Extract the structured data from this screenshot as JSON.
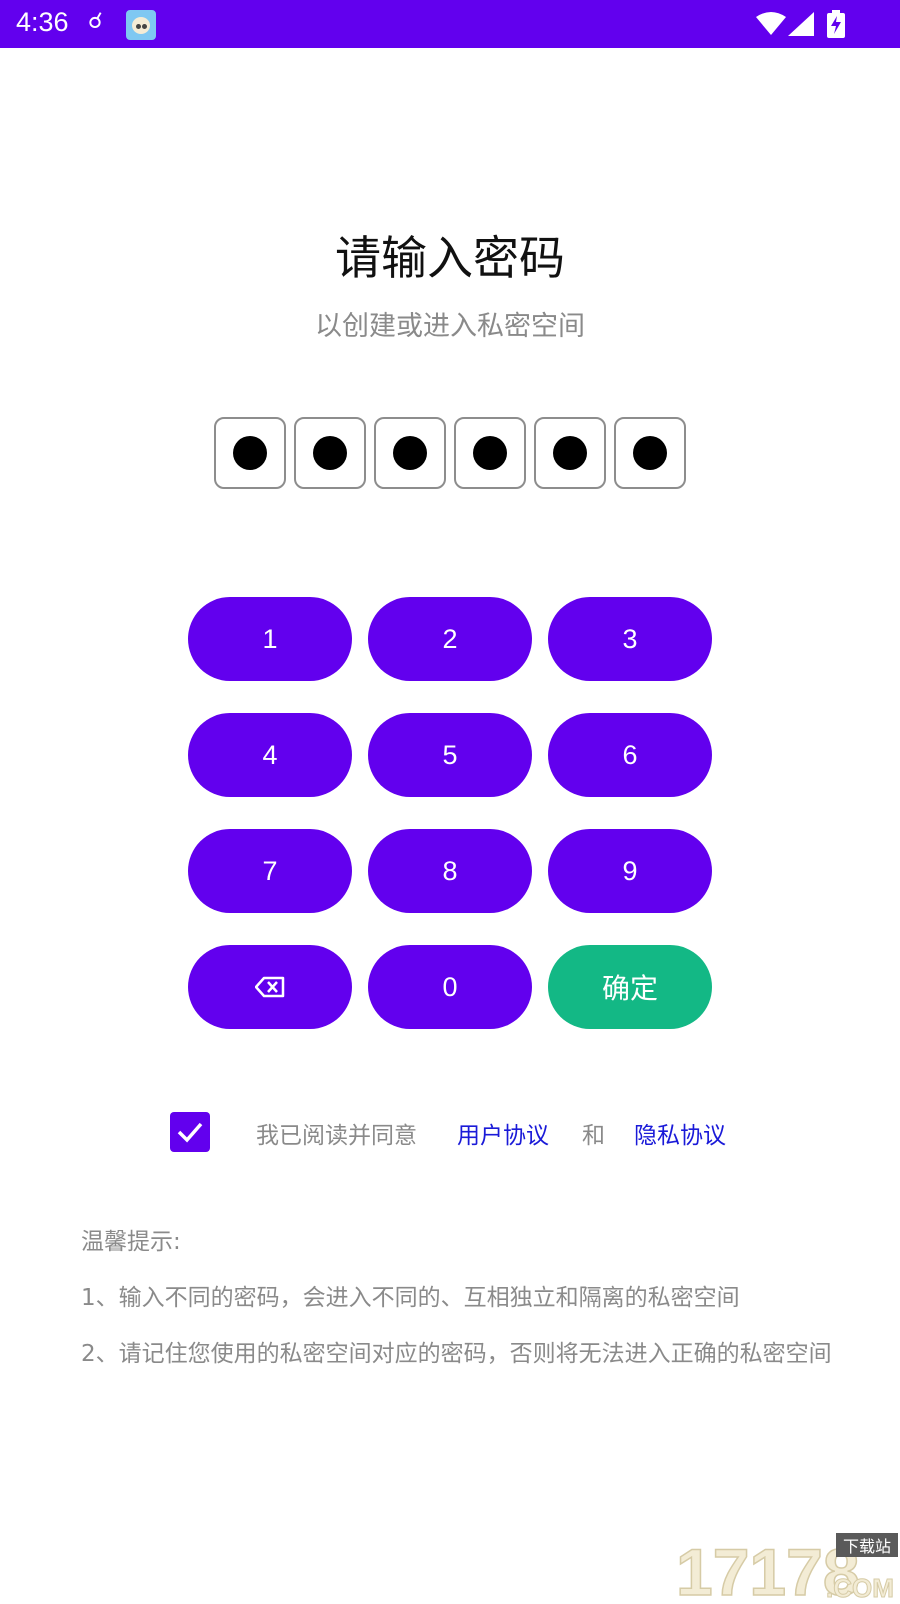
{
  "status_bar": {
    "time": "4:36",
    "notification_icon": "usb-icon",
    "app_icon": "baby-face-app-icon",
    "wifi_icon": "wifi-icon",
    "signal_icon": "cellular-signal-icon",
    "battery_icon": "battery-charging-icon",
    "background": "#6200ee"
  },
  "header": {
    "title": "请输入密码",
    "subtitle": "以创建或进入私密空间"
  },
  "pin": {
    "length": 6,
    "filled": 6
  },
  "keypad": {
    "keys": [
      "1",
      "2",
      "3",
      "4",
      "5",
      "6",
      "7",
      "8",
      "9",
      "⌫",
      "0",
      "确定"
    ],
    "key_color": "#6200ee",
    "confirm_color": "#13b885"
  },
  "agreement": {
    "checked": true,
    "text": "我已阅读并同意",
    "user_link": "用户协议",
    "and": "和",
    "privacy_link": "隐私协议"
  },
  "tips": {
    "title": "温馨提示:",
    "item1": "1、输入不同的密码，会进入不同的、互相独立和隔离的私密空间",
    "item2": "2、请记住您使用的私密空间对应的密码，否则将无法进入正确的私密空间"
  },
  "watermark": {
    "logo": "17178",
    "tag": "下载站",
    "suffix": ".COM"
  }
}
